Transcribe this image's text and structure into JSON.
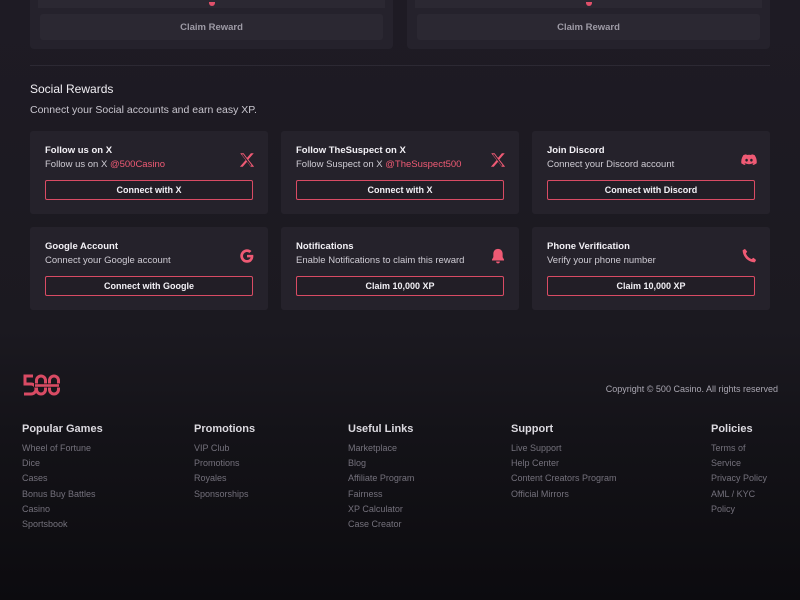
{
  "top_cards": [
    {
      "claim_label": "Claim Reward"
    },
    {
      "claim_label": "Claim Reward"
    }
  ],
  "social": {
    "title": "Social Rewards",
    "subtitle": "Connect your Social accounts and earn easy XP.",
    "cards": [
      {
        "title": "Follow us on X",
        "desc": "Follow us on X ",
        "handle": "@500Casino",
        "button": "Connect with X",
        "icon": "x-logo-icon"
      },
      {
        "title": "Follow TheSuspect on X",
        "desc": "Follow Suspect on X ",
        "handle": "@TheSuspect500",
        "button": "Connect with X",
        "icon": "x-logo-icon"
      },
      {
        "title": "Join Discord",
        "desc": "Connect your Discord account",
        "handle": "",
        "button": "Connect with Discord",
        "icon": "discord-icon"
      },
      {
        "title": "Google Account",
        "desc": "Connect your Google account",
        "handle": "",
        "button": "Connect with Google",
        "icon": "google-icon"
      },
      {
        "title": "Notifications",
        "desc": "Enable Notifications to claim this reward",
        "handle": "",
        "button": "Claim 10,000 XP",
        "icon": "bell-icon"
      },
      {
        "title": "Phone Verification",
        "desc": "Verify your phone number",
        "handle": "",
        "button": "Claim 10,000 XP",
        "icon": "phone-icon"
      }
    ]
  },
  "footer": {
    "copyright": "Copyright © 500 Casino. All rights reserved",
    "columns": [
      {
        "title": "Popular Games",
        "links": [
          "Wheel of Fortune",
          "Dice",
          "Cases",
          "Bonus Buy Battles",
          "Casino",
          "Sportsbook"
        ]
      },
      {
        "title": "Promotions",
        "links": [
          "VIP Club",
          "Promotions",
          "Royales",
          "Sponsorships"
        ]
      },
      {
        "title": "Useful Links",
        "links": [
          "Marketplace",
          "Blog",
          "Affiliate Program",
          "Fairness",
          "XP Calculator",
          "Case Creator"
        ]
      },
      {
        "title": "Support",
        "links": [
          "Live Support",
          "Help Center",
          "Content Creators Program",
          "Official Mirrors"
        ]
      },
      {
        "title": "Policies",
        "links": [
          "Terms of Service",
          "Privacy Policy",
          "AML / KYC Policy"
        ]
      }
    ]
  },
  "colors": {
    "accent": "#ef5a74",
    "background": "#1e1b24",
    "card": "#25222b"
  }
}
